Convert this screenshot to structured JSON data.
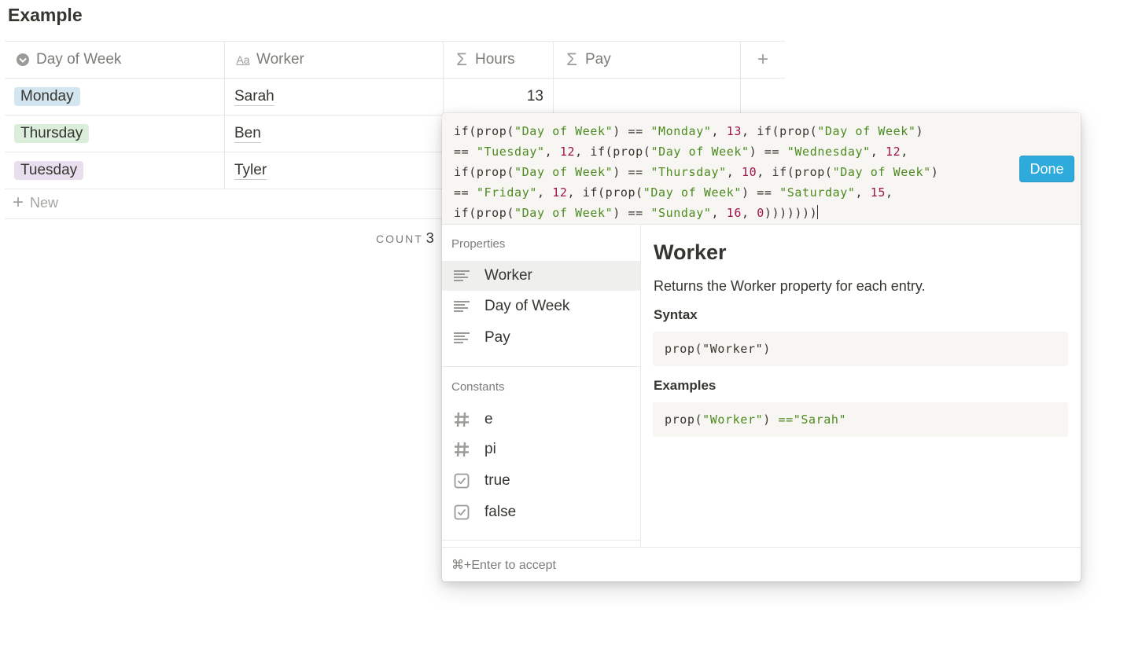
{
  "page": {
    "title": "Example"
  },
  "table": {
    "columns": [
      {
        "label": "Day of Week",
        "icon": "select-icon"
      },
      {
        "label": "Worker",
        "icon": "text-icon"
      },
      {
        "label": "Hours",
        "icon": "formula-icon"
      },
      {
        "label": "Pay",
        "icon": "formula-icon"
      }
    ],
    "rows": [
      {
        "day": "Monday",
        "day_color": "#d3e5ef",
        "worker": "Sarah",
        "hours": "13"
      },
      {
        "day": "Thursday",
        "day_color": "#dbeddb",
        "worker": "Ben",
        "hours": ""
      },
      {
        "day": "Tuesday",
        "day_color": "#e8deee",
        "worker": "Tyler",
        "hours": ""
      }
    ],
    "new_label": "New",
    "count_label": "COUNT",
    "count_value": "3"
  },
  "formula": {
    "expression": "if(prop(\"Day of Week\") == \"Monday\", 13, if(prop(\"Day of Week\") == \"Tuesday\", 12, if(prop(\"Day of Week\") == \"Wednesday\", 12, if(prop(\"Day of Week\") == \"Thursday\", 10, if(prop(\"Day of Week\") == \"Friday\", 12, if(prop(\"Day of Week\") == \"Saturday\", 15, if(prop(\"Day of Week\") == \"Sunday\", 16, 0)))))))",
    "done_label": "Done",
    "properties_label": "Properties",
    "properties": [
      "Worker",
      "Day of Week",
      "Pay"
    ],
    "constants_label": "Constants",
    "constants": [
      {
        "label": "e",
        "icon": "hash-icon"
      },
      {
        "label": "pi",
        "icon": "hash-icon"
      },
      {
        "label": "true",
        "icon": "checkbox-icon"
      },
      {
        "label": "false",
        "icon": "checkbox-icon"
      }
    ],
    "doc": {
      "title": "Worker",
      "description": "Returns the Worker property for each entry.",
      "syntax_label": "Syntax",
      "syntax_code": "prop(\"Worker\")",
      "examples_label": "Examples",
      "example_code": "prop(\"Worker\") == \"Sarah\""
    },
    "footer": "⌘+Enter to accept"
  },
  "colors": {
    "accent": "#2eaadc",
    "string": "#4d8a1f",
    "number": "#a0134b"
  }
}
